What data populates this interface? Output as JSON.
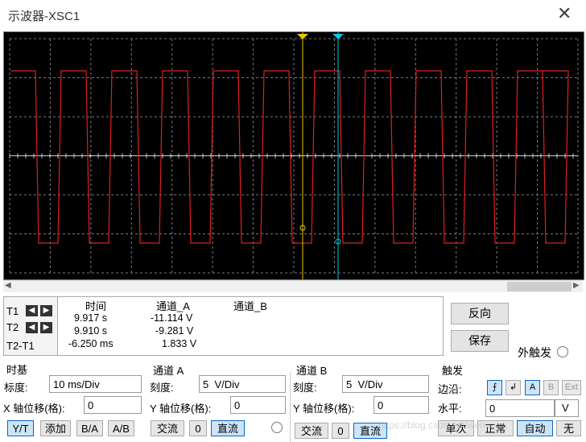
{
  "window": {
    "title": "示波器-XSC1",
    "close_glyph": "✕"
  },
  "cursors": {
    "t1_label": "T1",
    "t2_label": "T2",
    "diff_label": "T2-T1"
  },
  "readout": {
    "headers": [
      "时间",
      "通道_A",
      "通道_B"
    ],
    "rows": [
      {
        "time": "9.917 s",
        "a": "-11.114 V",
        "b": ""
      },
      {
        "time": "9.910 s",
        "a": "-9.281 V",
        "b": ""
      },
      {
        "time": "-6.250 ms",
        "a": "1.833 V",
        "b": ""
      }
    ]
  },
  "side_buttons": {
    "reverse": "反向",
    "save": "保存",
    "ext_trigger": "外触发"
  },
  "timebase": {
    "title": "时基",
    "scale_label": "标度:",
    "scale_value": "10 ms/Div",
    "xpos_label": "X 轴位移(格):",
    "xpos_value": "0",
    "modes": [
      "Y/T",
      "添加",
      "B/A",
      "A/B"
    ]
  },
  "channel_a": {
    "title": "通道 A",
    "scale_label": "刻度:",
    "scale_value": "5  V/Div",
    "ypos_label": "Y 轴位移(格):",
    "ypos_value": "0",
    "coupling": [
      "交流",
      "0",
      "直流"
    ]
  },
  "channel_b": {
    "title": "通道 B",
    "scale_label": "刻度:",
    "scale_value": "5  V/Div",
    "ypos_label": "Y 轴位移(格):",
    "ypos_value": "0",
    "coupling": [
      "交流",
      "0",
      "直流"
    ]
  },
  "trigger": {
    "title": "触发",
    "edge_label": "边沿:",
    "level_label": "水平:",
    "level_value": "0",
    "level_unit": "V",
    "sources": [
      "A",
      "B",
      "Ext"
    ],
    "modes": [
      "单次",
      "正常",
      "自动",
      "无"
    ]
  },
  "watermark": "https://blog.csdn.net/weixin_...",
  "colors": {
    "trace_a": "#e02020",
    "cursor1": "#e6c800",
    "cursor2": "#00c8e0",
    "screen": "#000000",
    "grid": "#7a7a7a"
  }
}
